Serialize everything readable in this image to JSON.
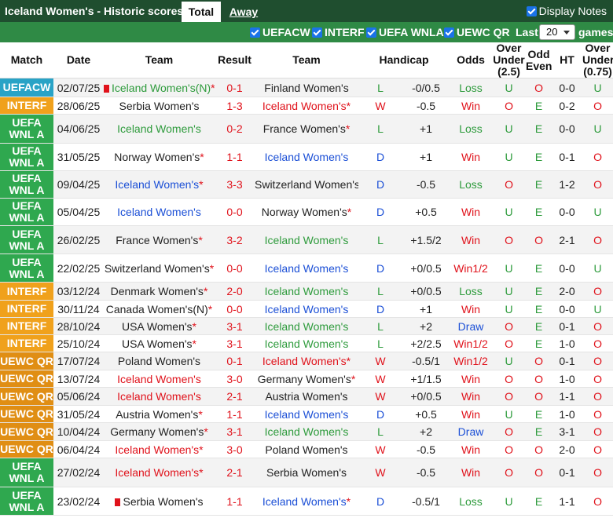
{
  "header": {
    "title": "Iceland Women's - Historic scores",
    "tabs": [
      "Total",
      "Away"
    ],
    "display_notes": "Display Notes"
  },
  "filters": {
    "items": [
      "UEFACW",
      "INTERF",
      "UEFA WNLA",
      "UEWC QR"
    ],
    "last_label": "Last",
    "last_value": "20",
    "games_label": "games"
  },
  "columns": [
    "Match",
    "Date",
    "Team",
    "Result",
    "Team",
    "Handicap",
    "Odds",
    "Over Under (2.5)",
    "Odd Even",
    "HT",
    "Over Under (0.75)"
  ],
  "colors": {
    "win": "#e0121b",
    "loss": "#2e9b3c",
    "draw": "#1b4fd6",
    "iceland_win": "#e0121b"
  },
  "rows": [
    {
      "comp": "UEFACW",
      "ctype": "uefacw",
      "date": "02/07/25",
      "home": "Iceland Women's(N)",
      "hc": "green",
      "hstar": true,
      "hcard": true,
      "score": "0-1",
      "away": "Finland Women's",
      "ac": "dark",
      "astar": false,
      "acard": false,
      "wl": "L",
      "hcp": "-0/0.5",
      "odds": "Loss",
      "ou": "U",
      "oe": "O",
      "ht": "0-0",
      "ou2": "U"
    },
    {
      "comp": "INTERF",
      "ctype": "interf",
      "date": "28/06/25",
      "home": "Serbia Women's",
      "hc": "dark",
      "hstar": false,
      "hcard": false,
      "score": "1-3",
      "away": "Iceland Women's",
      "ac": "red",
      "astar": true,
      "acard": false,
      "wl": "W",
      "hcp": "-0.5",
      "odds": "Win",
      "ou": "O",
      "oe": "E",
      "ht": "0-2",
      "ou2": "O"
    },
    {
      "comp": "UEFA WNL A",
      "ctype": "wnla",
      "date": "04/06/25",
      "home": "Iceland Women's",
      "hc": "green",
      "hstar": false,
      "hcard": false,
      "score": "0-2",
      "away": "France Women's",
      "ac": "dark",
      "astar": true,
      "acard": false,
      "wl": "L",
      "hcp": "+1",
      "odds": "Loss",
      "ou": "U",
      "oe": "E",
      "ht": "0-0",
      "ou2": "U"
    },
    {
      "comp": "UEFA WNL A",
      "ctype": "wnla",
      "date": "31/05/25",
      "home": "Norway Women's",
      "hc": "dark",
      "hstar": true,
      "hcard": false,
      "score": "1-1",
      "away": "Iceland Women's",
      "ac": "blue",
      "astar": false,
      "acard": false,
      "wl": "D",
      "hcp": "+1",
      "odds": "Win",
      "ou": "U",
      "oe": "E",
      "ht": "0-1",
      "ou2": "O"
    },
    {
      "comp": "UEFA WNL A",
      "ctype": "wnla",
      "date": "09/04/25",
      "home": "Iceland Women's",
      "hc": "blue",
      "hstar": true,
      "hcard": false,
      "score": "3-3",
      "away": "Switzerland Women's",
      "ac": "dark",
      "astar": false,
      "acard": true,
      "wl": "D",
      "hcp": "-0.5",
      "odds": "Loss",
      "ou": "O",
      "oe": "E",
      "ht": "1-2",
      "ou2": "O"
    },
    {
      "comp": "UEFA WNL A",
      "ctype": "wnla",
      "date": "05/04/25",
      "home": "Iceland Women's",
      "hc": "blue",
      "hstar": false,
      "hcard": false,
      "score": "0-0",
      "away": "Norway Women's",
      "ac": "dark",
      "astar": true,
      "acard": false,
      "wl": "D",
      "hcp": "+0.5",
      "odds": "Win",
      "ou": "U",
      "oe": "E",
      "ht": "0-0",
      "ou2": "U"
    },
    {
      "comp": "UEFA WNL A",
      "ctype": "wnla",
      "date": "26/02/25",
      "home": "France Women's",
      "hc": "dark",
      "hstar": true,
      "hcard": false,
      "score": "3-2",
      "away": "Iceland Women's",
      "ac": "green",
      "astar": false,
      "acard": false,
      "wl": "L",
      "hcp": "+1.5/2",
      "odds": "Win",
      "ou": "O",
      "oe": "O",
      "ht": "2-1",
      "ou2": "O"
    },
    {
      "comp": "UEFA WNL A",
      "ctype": "wnla",
      "date": "22/02/25",
      "home": "Switzerland Women's",
      "hc": "dark",
      "hstar": true,
      "hcard": false,
      "score": "0-0",
      "away": "Iceland Women's",
      "ac": "blue",
      "astar": false,
      "acard": false,
      "wl": "D",
      "hcp": "+0/0.5",
      "odds": "Win1/2",
      "ou": "U",
      "oe": "E",
      "ht": "0-0",
      "ou2": "U"
    },
    {
      "comp": "INTERF",
      "ctype": "interf",
      "date": "03/12/24",
      "home": "Denmark Women's",
      "hc": "dark",
      "hstar": true,
      "hcard": false,
      "score": "2-0",
      "away": "Iceland Women's",
      "ac": "green",
      "astar": false,
      "acard": false,
      "wl": "L",
      "hcp": "+0/0.5",
      "odds": "Loss",
      "ou": "U",
      "oe": "E",
      "ht": "2-0",
      "ou2": "O"
    },
    {
      "comp": "INTERF",
      "ctype": "interf",
      "date": "30/11/24",
      "home": "Canada Women's(N)",
      "hc": "dark",
      "hstar": true,
      "hcard": false,
      "score": "0-0",
      "away": "Iceland Women's",
      "ac": "blue",
      "astar": false,
      "acard": false,
      "wl": "D",
      "hcp": "+1",
      "odds": "Win",
      "ou": "U",
      "oe": "E",
      "ht": "0-0",
      "ou2": "U"
    },
    {
      "comp": "INTERF",
      "ctype": "interf",
      "date": "28/10/24",
      "home": "USA Women's",
      "hc": "dark",
      "hstar": true,
      "hcard": false,
      "score": "3-1",
      "away": "Iceland Women's",
      "ac": "green",
      "astar": false,
      "acard": false,
      "wl": "L",
      "hcp": "+2",
      "odds": "Draw",
      "ou": "O",
      "oe": "E",
      "ht": "0-1",
      "ou2": "O"
    },
    {
      "comp": "INTERF",
      "ctype": "interf",
      "date": "25/10/24",
      "home": "USA Women's",
      "hc": "dark",
      "hstar": true,
      "hcard": false,
      "score": "3-1",
      "away": "Iceland Women's",
      "ac": "green",
      "astar": false,
      "acard": false,
      "wl": "L",
      "hcp": "+2/2.5",
      "odds": "Win1/2",
      "ou": "O",
      "oe": "E",
      "ht": "1-0",
      "ou2": "O"
    },
    {
      "comp": "UEWC QR",
      "ctype": "uewc",
      "date": "17/07/24",
      "home": "Poland Women's",
      "hc": "dark",
      "hstar": false,
      "hcard": false,
      "score": "0-1",
      "away": "Iceland Women's",
      "ac": "red",
      "astar": true,
      "acard": false,
      "wl": "W",
      "hcp": "-0.5/1",
      "odds": "Win1/2",
      "ou": "U",
      "oe": "O",
      "ht": "0-1",
      "ou2": "O"
    },
    {
      "comp": "UEWC QR",
      "ctype": "uewc",
      "date": "13/07/24",
      "home": "Iceland Women's",
      "hc": "red",
      "hstar": false,
      "hcard": false,
      "score": "3-0",
      "away": "Germany Women's",
      "ac": "dark",
      "astar": true,
      "acard": false,
      "wl": "W",
      "hcp": "+1/1.5",
      "odds": "Win",
      "ou": "O",
      "oe": "O",
      "ht": "1-0",
      "ou2": "O"
    },
    {
      "comp": "UEWC QR",
      "ctype": "uewc",
      "date": "05/06/24",
      "home": "Iceland Women's",
      "hc": "red",
      "hstar": false,
      "hcard": false,
      "score": "2-1",
      "away": "Austria Women's",
      "ac": "dark",
      "astar": false,
      "acard": false,
      "wl": "W",
      "hcp": "+0/0.5",
      "odds": "Win",
      "ou": "O",
      "oe": "O",
      "ht": "1-1",
      "ou2": "O"
    },
    {
      "comp": "UEWC QR",
      "ctype": "uewc",
      "date": "31/05/24",
      "home": "Austria Women's",
      "hc": "dark",
      "hstar": true,
      "hcard": false,
      "score": "1-1",
      "away": "Iceland Women's",
      "ac": "blue",
      "astar": false,
      "acard": false,
      "wl": "D",
      "hcp": "+0.5",
      "odds": "Win",
      "ou": "U",
      "oe": "E",
      "ht": "1-0",
      "ou2": "O"
    },
    {
      "comp": "UEWC QR",
      "ctype": "uewc",
      "date": "10/04/24",
      "home": "Germany Women's",
      "hc": "dark",
      "hstar": true,
      "hcard": false,
      "score": "3-1",
      "away": "Iceland Women's",
      "ac": "green",
      "astar": false,
      "acard": false,
      "wl": "L",
      "hcp": "+2",
      "odds": "Draw",
      "ou": "O",
      "oe": "E",
      "ht": "3-1",
      "ou2": "O"
    },
    {
      "comp": "UEWC QR",
      "ctype": "uewc",
      "date": "06/04/24",
      "home": "Iceland Women's",
      "hc": "red",
      "hstar": true,
      "hcard": false,
      "score": "3-0",
      "away": "Poland Women's",
      "ac": "dark",
      "astar": false,
      "acard": false,
      "wl": "W",
      "hcp": "-0.5",
      "odds": "Win",
      "ou": "O",
      "oe": "O",
      "ht": "2-0",
      "ou2": "O"
    },
    {
      "comp": "UEFA WNL A",
      "ctype": "wnla",
      "date": "27/02/24",
      "home": "Iceland Women's",
      "hc": "red",
      "hstar": true,
      "hcard": false,
      "score": "2-1",
      "away": "Serbia Women's",
      "ac": "dark",
      "astar": false,
      "acard": false,
      "wl": "W",
      "hcp": "-0.5",
      "odds": "Win",
      "ou": "O",
      "oe": "O",
      "ht": "0-1",
      "ou2": "O"
    },
    {
      "comp": "UEFA WNL A",
      "ctype": "wnla",
      "date": "23/02/24",
      "home": "Serbia Women's",
      "hc": "dark",
      "hstar": false,
      "hcard": true,
      "score": "1-1",
      "away": "Iceland Women's",
      "ac": "blue",
      "astar": true,
      "acard": false,
      "wl": "D",
      "hcp": "-0.5/1",
      "odds": "Loss",
      "ou": "U",
      "oe": "E",
      "ht": "1-1",
      "ou2": "O"
    }
  ]
}
